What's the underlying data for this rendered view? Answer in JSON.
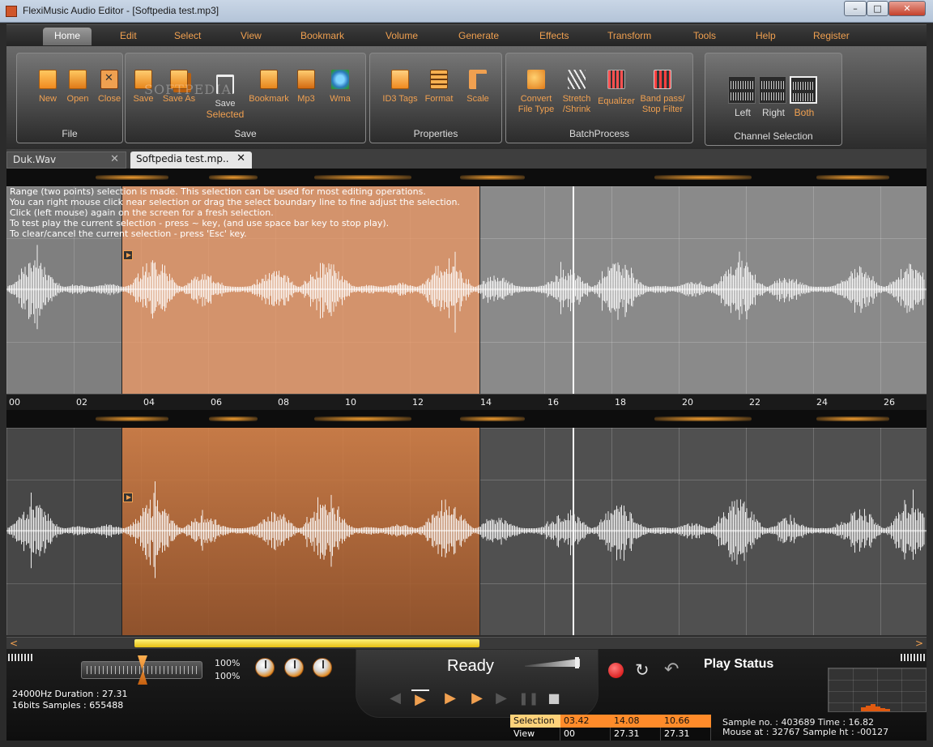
{
  "window": {
    "title": "FlexiMusic Audio Editor - [Softpedia test.mp3]",
    "min_glyph": "–",
    "max_glyph": "□",
    "close_glyph": "✕"
  },
  "menu": [
    "Home",
    "Edit",
    "Select",
    "View",
    "Bookmark",
    "Volume",
    "Generate",
    "Effects",
    "Transform",
    "Tools",
    "Help",
    "Register"
  ],
  "ribbon": {
    "file": {
      "label": "File",
      "new": "New",
      "open": "Open",
      "close": "Close"
    },
    "save": {
      "label": "Save",
      "save": "Save",
      "save_as": "Save As",
      "save_selected_1": "Save",
      "save_selected_2": "Selected",
      "bookmark": "Bookmark",
      "mp3": "Mp3",
      "wma": "Wma"
    },
    "properties": {
      "label": "Properties",
      "id3": "ID3 Tags",
      "format": "Format",
      "scale": "Scale"
    },
    "batch": {
      "label": "BatchProcess",
      "convert_1": "Convert",
      "convert_2": "File Type",
      "stretch_1": "Stretch",
      "stretch_2": "/Shrink",
      "equalizer": "Equalizer",
      "band_1": "Band pass/",
      "band_2": "Stop Filter"
    },
    "channel": {
      "label": "Channel Selection",
      "left": "Left",
      "right": "Right",
      "both": "Both"
    },
    "watermark": "SOFTPEDIA"
  },
  "doc_tabs": [
    {
      "label": "Duk.Wav",
      "close": "✕"
    },
    {
      "label": "Softpedia test.mp..",
      "close": "✕"
    }
  ],
  "hint_lines": [
    "Range (two points) selection is made. This selection can be used for most editing operations.",
    "You can right mouse click near selection or drag the select boundary line to fine adjust the selection.",
    "Click (left mouse) again on the screen for a fresh selection.",
    "To test play the current selection - press ~ key, (and use space bar key to stop play).",
    "To clear/cancel the current selection - press 'Esc' key."
  ],
  "timeline": [
    "00",
    "02",
    "04",
    "06",
    "08",
    "10",
    "12",
    "14",
    "16",
    "18",
    "20",
    "22",
    "24",
    "26"
  ],
  "scroll": {
    "left": "<",
    "right": ">"
  },
  "levels": {
    "left_pct": "100%",
    "right_pct": "100%"
  },
  "file_info": {
    "line1": "24000Hz  Duration : 27.31",
    "line2": "16bits  Samples : 655488"
  },
  "status": {
    "ready": "Ready",
    "play_status": "Play Status"
  },
  "transport": {
    "prev": "◀",
    "play_sel": "▶",
    "play_view": "▶",
    "play": "▶",
    "next": "▶",
    "pause": "❚❚",
    "stop": "■",
    "loop": "↻",
    "return": "↶"
  },
  "selection_table": {
    "selection": {
      "label": "Selection",
      "start": "03.42",
      "end": "14.08",
      "length": "10.66"
    },
    "view": {
      "label": "View",
      "start": "00",
      "end": "27.31",
      "length": "27.31"
    }
  },
  "sample_info": {
    "line1": "Sample no. : 403689  Time : 16.82",
    "line2": "Mouse at : 32767   Sample ht : -00127"
  },
  "colors": {
    "accent": "#f0a050",
    "selection_top": "#e8966a",
    "selection_bottom": "#c0703a",
    "scroll_thumb": "#f2d63a"
  }
}
